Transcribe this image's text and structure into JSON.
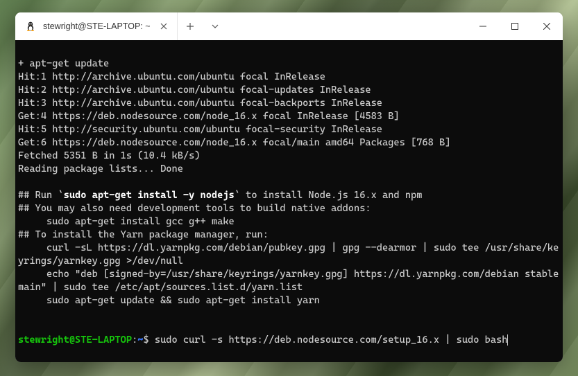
{
  "titlebar": {
    "tab_title": "stewright@STE-LAPTOP: ~"
  },
  "terminal": {
    "lines": {
      "l0": "",
      "l1": "+ apt-get update",
      "l2": "Hit:1 http://archive.ubuntu.com/ubuntu focal InRelease",
      "l3": "Hit:2 http://archive.ubuntu.com/ubuntu focal-updates InRelease",
      "l4": "Hit:3 http://archive.ubuntu.com/ubuntu focal-backports InRelease",
      "l5": "Get:4 https://deb.nodesource.com/node_16.x focal InRelease [4583 B]",
      "l6": "Hit:5 http://security.ubuntu.com/ubuntu focal-security InRelease",
      "l7": "Get:6 https://deb.nodesource.com/node_16.x focal/main amd64 Packages [768 B]",
      "l8": "Fetched 5351 B in 1s (10.4 kB/s)",
      "l9": "Reading package lists... Done",
      "l10": "",
      "l11_a": "## Run `",
      "l11_b": "sudo apt-get install -y nodejs",
      "l11_c": "` to install Node.js 16.x and npm",
      "l12": "## You may also need development tools to build native addons:",
      "l13": "     sudo apt-get install gcc g++ make",
      "l14": "## To install the Yarn package manager, run:",
      "l15": "     curl -sL https://dl.yarnpkg.com/debian/pubkey.gpg | gpg --dearmor | sudo tee /usr/share/keyrings/yarnkey.gpg >/dev/null",
      "l16": "     echo \"deb [signed-by=/usr/share/keyrings/yarnkey.gpg] https://dl.yarnpkg.com/debian stable main\" | sudo tee /etc/apt/sources.list.d/yarn.list",
      "l17": "     sudo apt-get update && sudo apt-get install yarn",
      "l18": "",
      "l19": ""
    },
    "prompt": {
      "user_host": "stewright@STE-LAPTOP",
      "colon": ":",
      "path": "~",
      "dollar": "$ ",
      "command": "sudo curl -s https://deb.nodesource.com/setup_16.x | sudo bash"
    }
  }
}
